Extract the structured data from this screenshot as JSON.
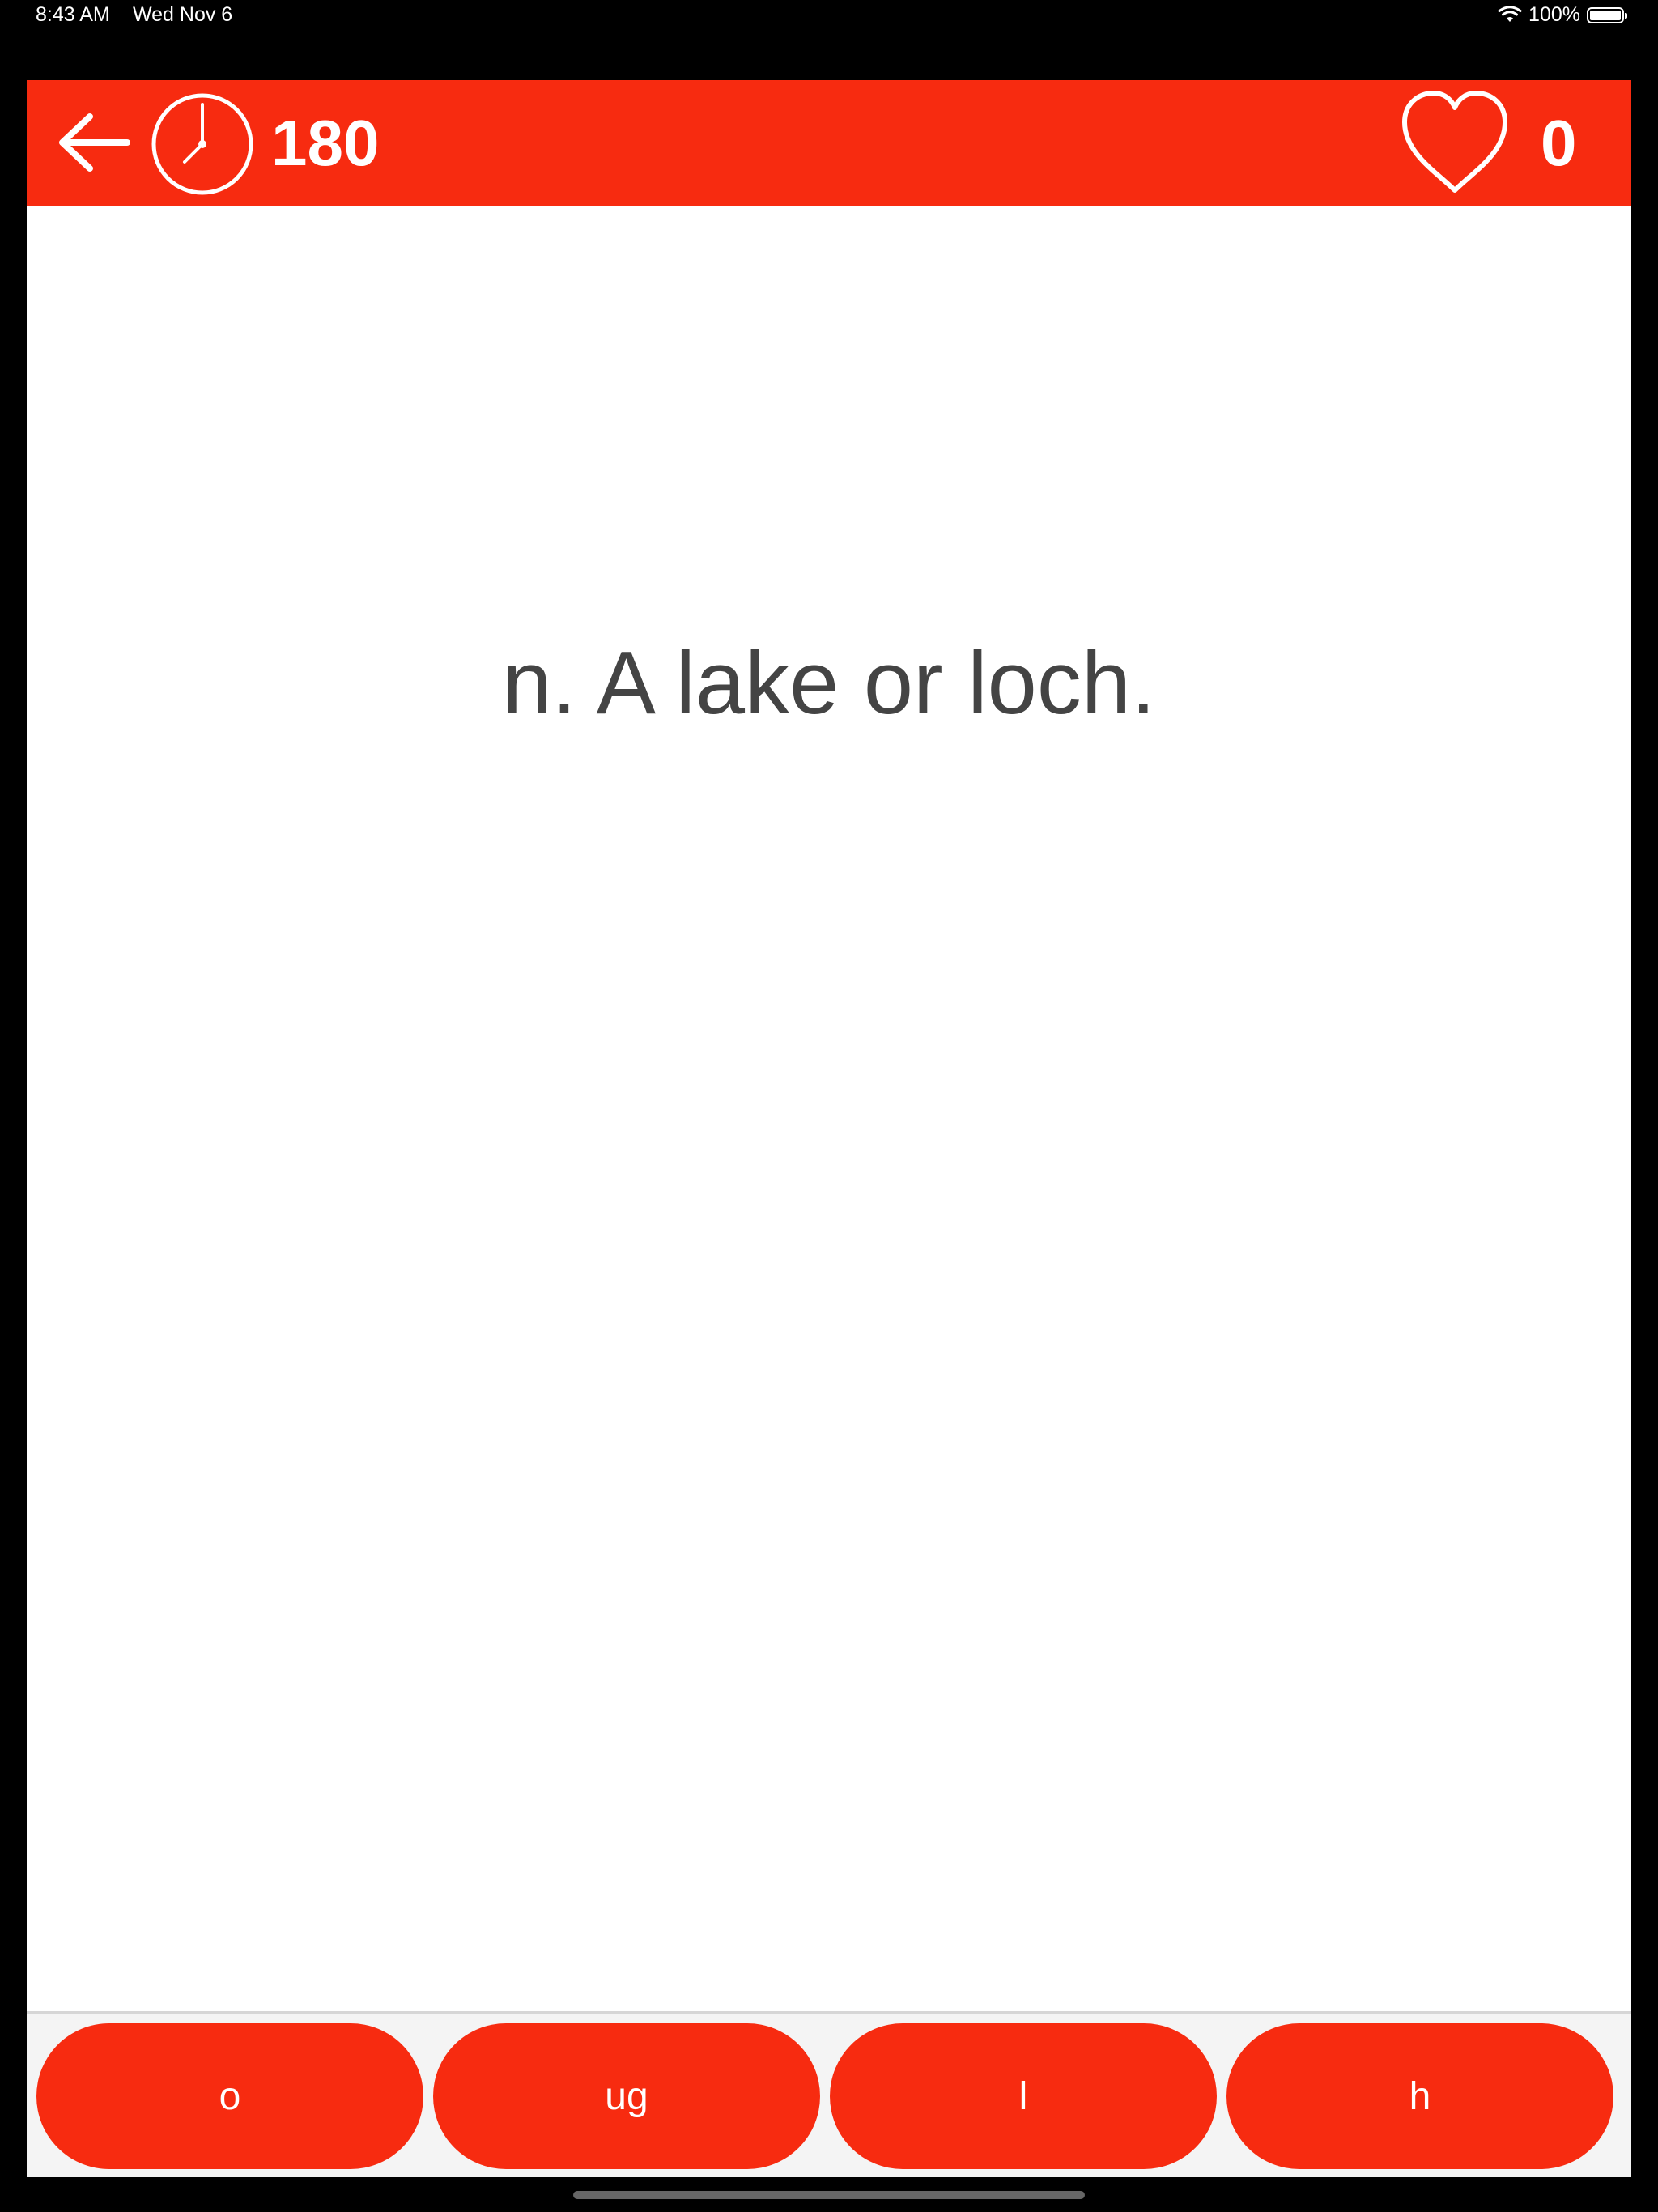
{
  "status_bar": {
    "time": "8:43 AM",
    "date": "Wed Nov 6",
    "battery_text": "100%",
    "battery_level_fraction": 1.0,
    "wifi_icon": "wifi-icon",
    "battery_icon": "battery-icon"
  },
  "toolbar": {
    "background_color": "#f72b10",
    "back_icon": "arrow-left-icon",
    "timer_icon": "clock-icon",
    "timer_value": "180",
    "lives_icon": "heart-icon",
    "score_value": "0"
  },
  "question": {
    "text": "n. A lake or loch."
  },
  "answers": [
    {
      "label": "o"
    },
    {
      "label": "ug"
    },
    {
      "label": "l"
    },
    {
      "label": "h"
    }
  ],
  "colors": {
    "accent": "#f72b10",
    "question_text": "#444444",
    "tray_background": "#f4f4f4"
  }
}
